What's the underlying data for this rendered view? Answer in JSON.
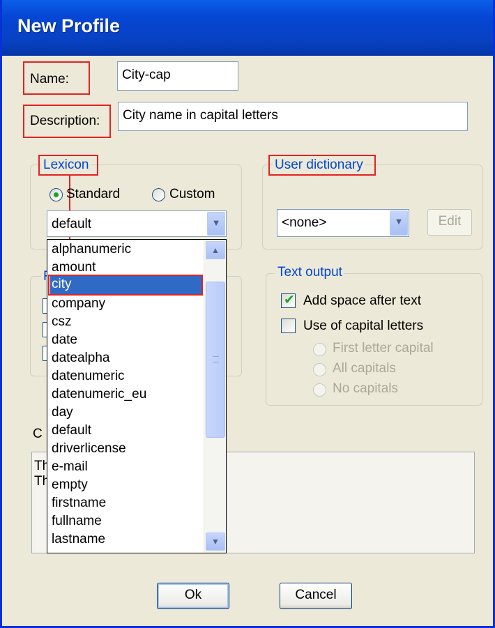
{
  "window": {
    "title": "New Profile"
  },
  "form": {
    "name_label": "Name:",
    "name_value": "City-cap",
    "description_label": "Description:",
    "description_value": "City name in capital letters"
  },
  "lexicon": {
    "legend": "Lexicon",
    "standard_label": "Standard",
    "custom_label": "Custom",
    "selected_mode": "Standard",
    "combo_value": "default"
  },
  "user_dictionary": {
    "legend": "User dictionary",
    "combo_value": "<none>",
    "edit_button": "Edit"
  },
  "text_output": {
    "legend": "Text output",
    "add_space_label": "Add space after text",
    "add_space_checked": true,
    "capitals_label": "Use of capital letters",
    "capitals_checked": false,
    "options": [
      "First letter capital",
      "All capitals",
      "No capitals"
    ]
  },
  "obscured": {
    "f_label": "F",
    "c_label": "C",
    "th1": "Th",
    "th2": "Th"
  },
  "dropdown": {
    "items": [
      "alphanumeric",
      "amount",
      "city",
      "company",
      "csz",
      "date",
      "datealpha",
      "datenumeric",
      "datenumeric_eu",
      "day",
      "default",
      "driverlicense",
      "e-mail",
      "empty",
      "firstname",
      "fullname",
      "lastname"
    ],
    "selected": "city"
  },
  "buttons": {
    "ok": "Ok",
    "cancel": "Cancel"
  },
  "colors": {
    "accent": "#316AC5",
    "annotation": "#E52121",
    "legend": "#0046D5",
    "check": "#21A121"
  }
}
